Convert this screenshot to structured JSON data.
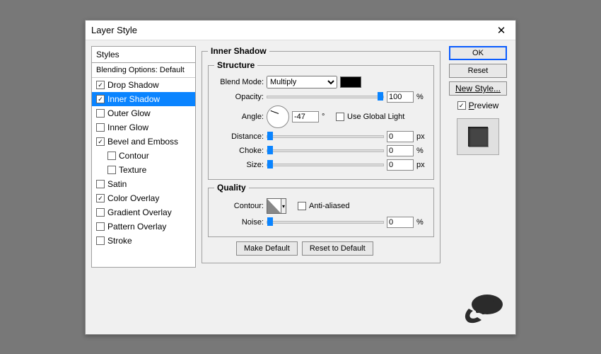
{
  "dialog": {
    "title": "Layer Style"
  },
  "styles_header": "Styles",
  "blending_header": "Blending Options: Default",
  "style_list": [
    {
      "label": "Drop Shadow",
      "checked": true
    },
    {
      "label": "Inner Shadow",
      "checked": true,
      "selected": true
    },
    {
      "label": "Outer Glow",
      "checked": false
    },
    {
      "label": "Inner Glow",
      "checked": false
    },
    {
      "label": "Bevel and Emboss",
      "checked": true
    },
    {
      "label": "Contour",
      "checked": false,
      "indent": true
    },
    {
      "label": "Texture",
      "checked": false,
      "indent": true
    },
    {
      "label": "Satin",
      "checked": false
    },
    {
      "label": "Color Overlay",
      "checked": true
    },
    {
      "label": "Gradient Overlay",
      "checked": false
    },
    {
      "label": "Pattern Overlay",
      "checked": false
    },
    {
      "label": "Stroke",
      "checked": false
    }
  ],
  "panel": {
    "title": "Inner Shadow",
    "structure_title": "Structure",
    "quality_title": "Quality",
    "blend_mode_label": "Blend Mode:",
    "blend_mode_value": "Multiply",
    "opacity_label": "Opacity:",
    "opacity_value": "100",
    "opacity_unit": "%",
    "angle_label": "Angle:",
    "angle_value": "-47",
    "angle_unit": "°",
    "use_global_label": "Use Global Light",
    "use_global_checked": false,
    "distance_label": "Distance:",
    "distance_value": "0",
    "distance_unit": "px",
    "choke_label": "Choke:",
    "choke_value": "0",
    "choke_unit": "%",
    "size_label": "Size:",
    "size_value": "0",
    "size_unit": "px",
    "contour_label": "Contour:",
    "antialiased_label": "Anti-aliased",
    "antialiased_checked": false,
    "noise_label": "Noise:",
    "noise_value": "0",
    "noise_unit": "%",
    "make_default": "Make Default",
    "reset_default": "Reset to Default"
  },
  "buttons": {
    "ok": "OK",
    "reset": "Reset",
    "new_style": "New Style...",
    "preview_label": "Preview",
    "preview_checked": true
  }
}
